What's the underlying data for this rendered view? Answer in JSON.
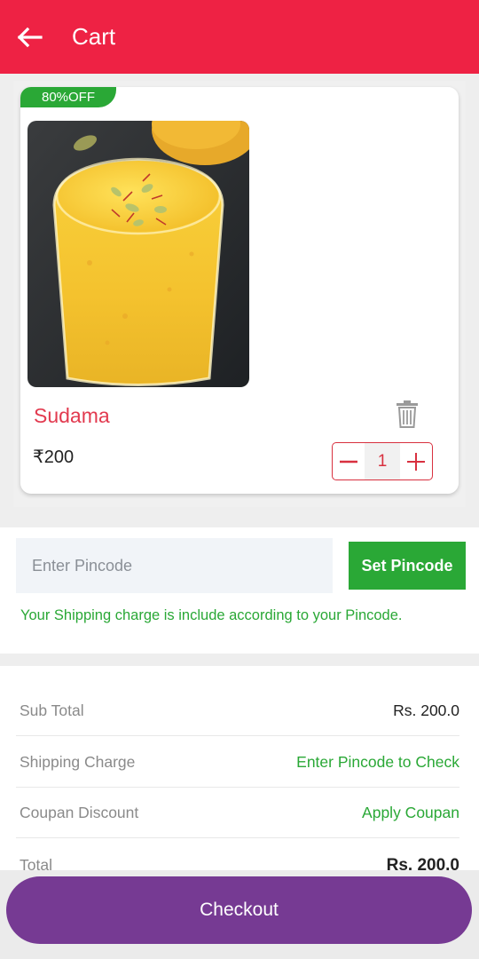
{
  "header": {
    "title": "Cart",
    "back_icon": "arrow-left-icon",
    "bg_color": "#ee2244"
  },
  "cart": {
    "items": [
      {
        "badge": "80%OFF",
        "name": "Sudama",
        "price": "₹200",
        "quantity": "1",
        "image": "mango-lassi-glass"
      }
    ]
  },
  "pincode": {
    "placeholder": "Enter Pincode",
    "button_label": "Set Pincode",
    "note": "Your Shipping charge is include according to your Pincode."
  },
  "summary": {
    "rows": [
      {
        "label": "Sub Total",
        "value": "Rs. 200.0"
      },
      {
        "label": "Shipping Charge",
        "value": "Enter Pincode to Check"
      },
      {
        "label": "Coupan Discount",
        "value": "Apply Coupan"
      },
      {
        "label": "Total",
        "value": "Rs. 200.0"
      }
    ]
  },
  "checkout": {
    "label": "Checkout",
    "color": "#763a93"
  },
  "colors": {
    "accent_green": "#2aa836",
    "product_red": "#e23a4f"
  }
}
